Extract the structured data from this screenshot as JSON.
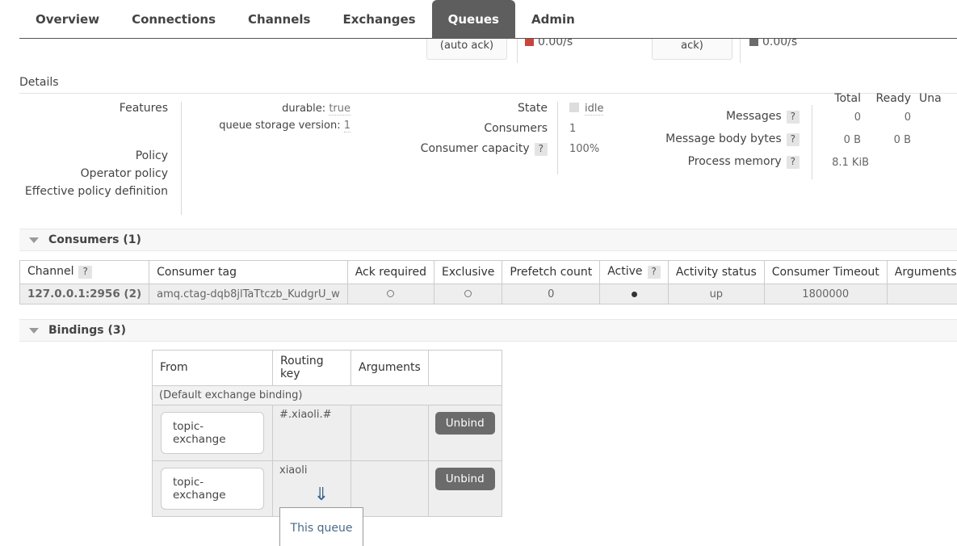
{
  "nav": {
    "items": [
      {
        "label": "Overview",
        "active": false
      },
      {
        "label": "Connections",
        "active": false
      },
      {
        "label": "Channels",
        "active": false
      },
      {
        "label": "Exchanges",
        "active": false
      },
      {
        "label": "Queues",
        "active": true
      },
      {
        "label": "Admin",
        "active": false
      }
    ]
  },
  "clipped_chart": {
    "legend_boxes": [
      {
        "label": "(auto ack)"
      },
      {
        "label": "ack)"
      }
    ],
    "rates": [
      {
        "color": "#c9453b",
        "value": "0.00/s"
      },
      {
        "color": "#6b6b6b",
        "value": "0.00/s"
      }
    ]
  },
  "details": {
    "title": "Details",
    "features": {
      "label": "Features",
      "rows": [
        {
          "key": "durable:",
          "value": "true"
        },
        {
          "key": "queue storage version:",
          "value": "1"
        }
      ]
    },
    "policy_label": "Policy",
    "operator_policy_label": "Operator policy",
    "effective_policy_label": "Effective policy definition",
    "state": {
      "label": "State",
      "value": "idle",
      "indicator_color": "#dddddd"
    },
    "consumers": {
      "label": "Consumers",
      "value": "1"
    },
    "consumer_capacity": {
      "label": "Consumer capacity",
      "help": "?",
      "value": "100%"
    },
    "stats": {
      "columns": [
        "Total",
        "Ready",
        "Una"
      ],
      "rows": [
        {
          "label": "Messages",
          "help": "?",
          "total": "0",
          "ready": "0"
        },
        {
          "label": "Message body bytes",
          "help": "?",
          "total": "0 B",
          "ready": "0 B"
        },
        {
          "label": "Process memory",
          "help": "?",
          "total": "8.1 KiB",
          "ready": ""
        }
      ]
    }
  },
  "consumers_section": {
    "title": "Consumers (1)",
    "columns": [
      "Channel",
      "Consumer tag",
      "Ack required",
      "Exclusive",
      "Prefetch count",
      "Active",
      "Activity status",
      "Consumer Timeout",
      "Arguments"
    ],
    "channel_help": "?",
    "active_help": "?",
    "rows": [
      {
        "channel": "127.0.0.1:2956 (2)",
        "consumer_tag": "amq.ctag-dqb8jlTaTtczb_KudgrU_w",
        "ack_required": "circle",
        "exclusive": "circle",
        "prefetch_count": "0",
        "active": "dot",
        "activity_status": "up",
        "consumer_timeout": "1800000",
        "arguments": ""
      }
    ]
  },
  "bindings_section": {
    "title": "Bindings (3)",
    "columns": [
      "From",
      "Routing key",
      "Arguments",
      ""
    ],
    "default_binding_label": "(Default exchange binding)",
    "rows": [
      {
        "from": "topic-exchange",
        "routing_key": "#.xiaoli.#",
        "arguments": "",
        "action": "Unbind"
      },
      {
        "from": "topic-exchange",
        "routing_key": "xiaoli",
        "arguments": "",
        "action": "Unbind"
      }
    ]
  },
  "queue_diagram": {
    "arrow": "⇓",
    "label": "This queue"
  }
}
